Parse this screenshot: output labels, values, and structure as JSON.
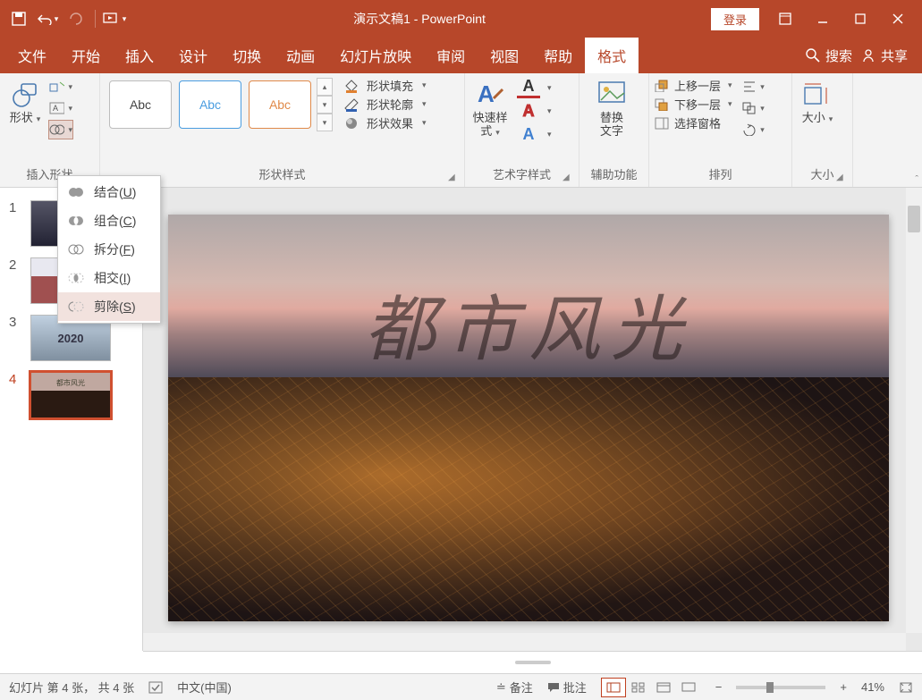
{
  "app": {
    "title": "演示文稿1 - PowerPoint",
    "login_label": "登录"
  },
  "tabs": {
    "file": "文件",
    "home": "开始",
    "insert": "插入",
    "design": "设计",
    "transition": "切换",
    "animation": "动画",
    "slideshow": "幻灯片放映",
    "review": "审阅",
    "view": "视图",
    "help": "帮助",
    "format": "格式",
    "search_label": "搜索",
    "share_label": "共享"
  },
  "ribbon": {
    "insert_shapes": {
      "label": "插入形状",
      "shapes_btn": "形状"
    },
    "shape_styles": {
      "label": "形状样式",
      "sample_text": "Abc",
      "fill": "形状填充",
      "outline": "形状轮廓",
      "effects": "形状效果"
    },
    "wordart_styles": {
      "label": "艺术字样式",
      "quick_styles": "快速样式"
    },
    "accessibility": {
      "label": "辅助功能",
      "alt_text": "替换\n文字"
    },
    "arrange": {
      "label": "排列",
      "bring_forward": "上移一层",
      "send_backward": "下移一层",
      "selection_pane": "选择窗格"
    },
    "size": {
      "label": "大小"
    }
  },
  "merge_menu": {
    "union": "结合",
    "union_key": "U",
    "combine": "组合",
    "combine_key": "C",
    "fragment": "拆分",
    "fragment_key": "F",
    "intersect": "相交",
    "intersect_key": "I",
    "subtract": "剪除",
    "subtract_key": "S"
  },
  "thumbnails": [
    {
      "num": "1",
      "label": ""
    },
    {
      "num": "2",
      "label": ""
    },
    {
      "num": "3",
      "label": "2020"
    },
    {
      "num": "4",
      "label": "都市风光"
    }
  ],
  "slide": {
    "title_text": "都市风光"
  },
  "status": {
    "slide_info": "幻灯片 第 4 张， 共 4 张",
    "language": "中文(中国)",
    "notes": "备注",
    "comments": "批注",
    "zoom_percent": "41%"
  }
}
